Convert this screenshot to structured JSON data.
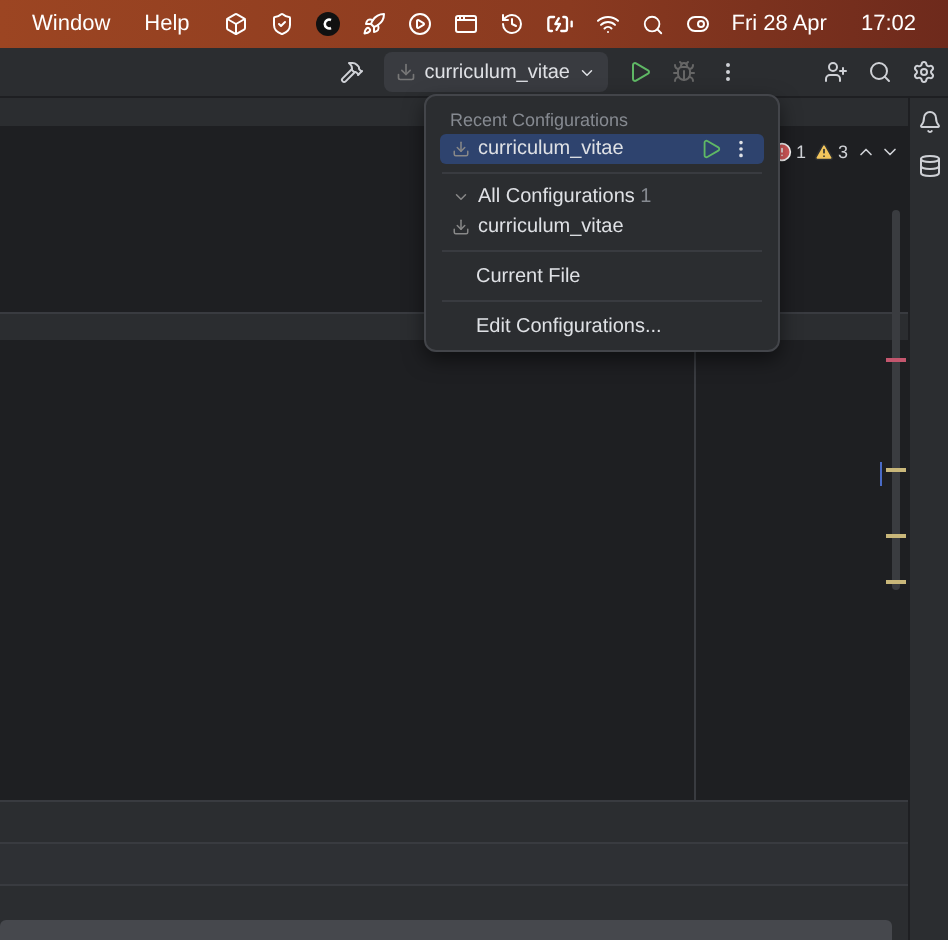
{
  "menu_bar": {
    "menus": [
      "Window",
      "Help"
    ],
    "date": "Fri 28 Apr",
    "time": "17:02"
  },
  "toolbar": {
    "run_config": "curriculum_vitae"
  },
  "popup": {
    "header": "Recent Configurations",
    "recent": [
      {
        "label": "curriculum_vitae",
        "selected": true
      }
    ],
    "group": {
      "label": "All Configurations",
      "count": "1",
      "expanded": true,
      "children": [
        {
          "label": "curriculum_vitae"
        }
      ]
    },
    "actions": [
      "Current File",
      "Edit Configurations..."
    ]
  },
  "inspections": {
    "errors": "1",
    "warnings": "3"
  },
  "stripe_marks": [
    {
      "color": "#c4566e"
    },
    {
      "color": "#c9b77a"
    },
    {
      "color": "#c9b77a"
    },
    {
      "color": "#c9b77a"
    }
  ]
}
